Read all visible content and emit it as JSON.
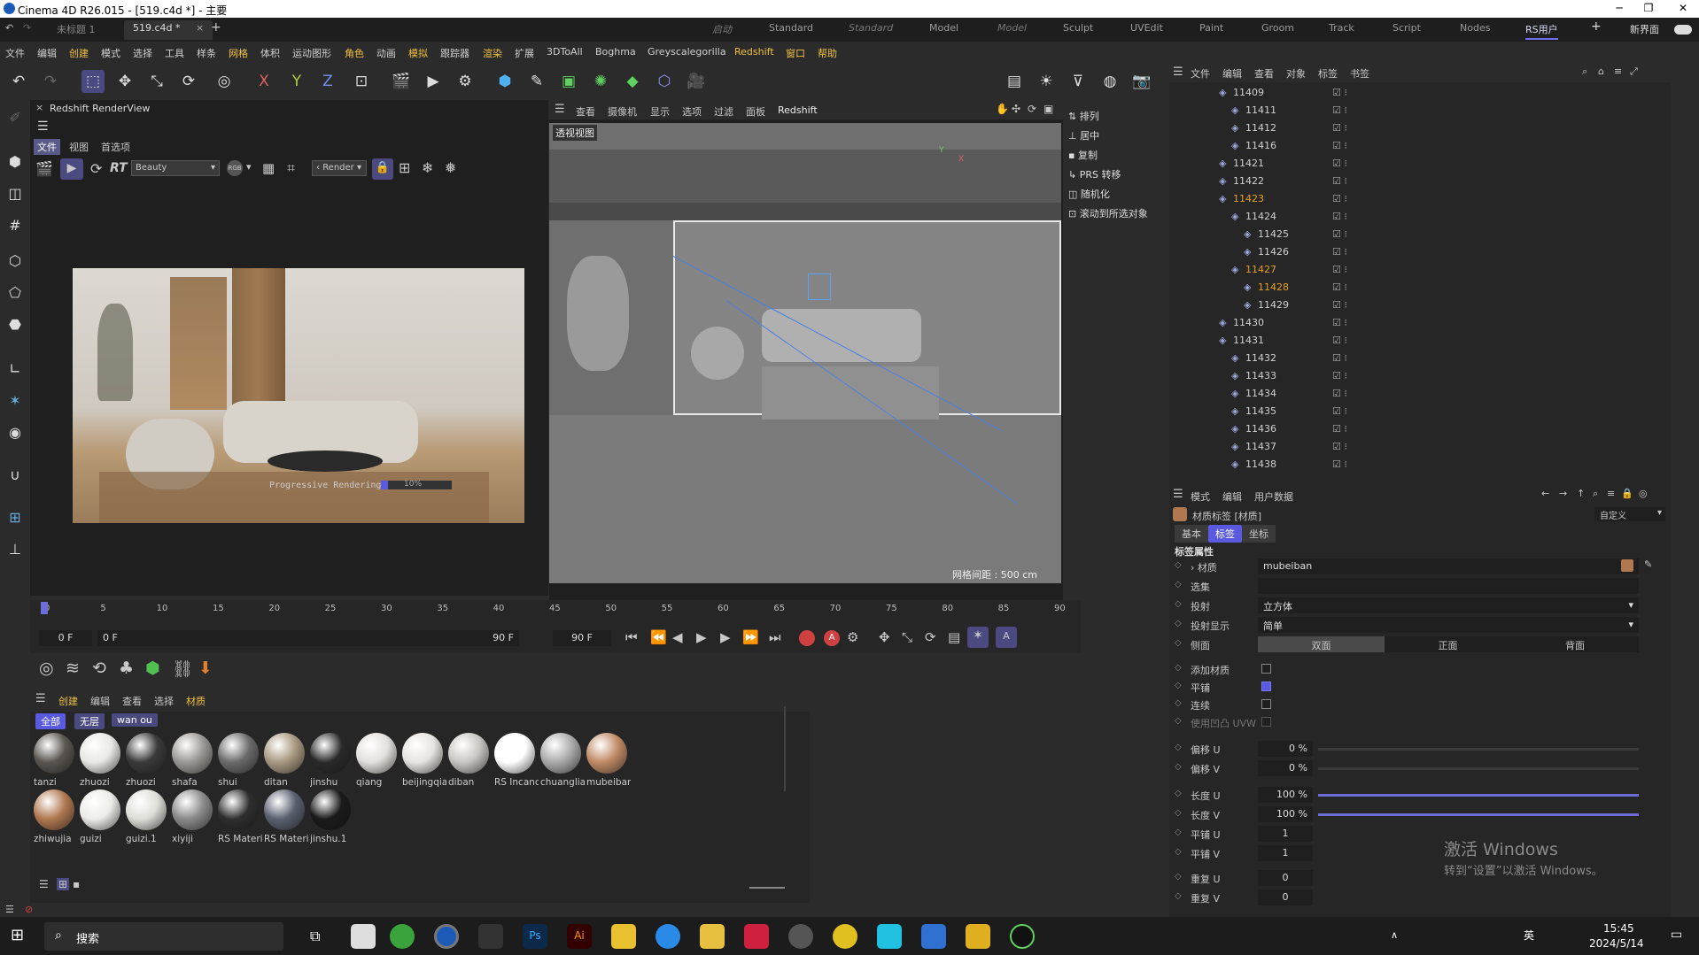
{
  "window": {
    "title": "Cinema 4D R26.015 - [519.c4d *] - 主要"
  },
  "tabs": [
    {
      "label": "未标题 1"
    },
    {
      "label": "519.c4d *"
    }
  ],
  "layouts": [
    "启动",
    "Standard",
    "Standard",
    "Model",
    "Model",
    "Sculpt",
    "UVEdit",
    "Paint",
    "Groom",
    "Track",
    "Script",
    "Nodes",
    "RS用户",
    "新界面"
  ],
  "menu": [
    "文件",
    "编辑",
    "创建",
    "模式",
    "选择",
    "工具",
    "样条",
    "网格",
    "体积",
    "运动图形",
    "角色",
    "动画",
    "模拟",
    "跟踪器",
    "渲染",
    "扩展",
    "3DToAll",
    "Boghma",
    "Greyscalegorilla",
    "Redshift",
    "窗口",
    "帮助"
  ],
  "renderview": {
    "title": "Redshift RenderView",
    "menu": [
      "文件",
      "视图",
      "首选项"
    ],
    "aov": "Beauty",
    "rgb": "RGB",
    "render_label": "Render",
    "rt_label": "RT",
    "progress_text": "Progressive Rendering...",
    "progress_pct": "10%",
    "progress_value": 0.1
  },
  "viewport": {
    "menu": [
      "查看",
      "摄像机",
      "显示",
      "选项",
      "过滤",
      "面板",
      "Redshift"
    ],
    "label": "透视视图",
    "grid": "网格间距 : 500 cm",
    "axis_y": "Y",
    "axis_x": "X"
  },
  "attr_tools": [
    "排列",
    "居中",
    "复制",
    "PRS 转移",
    "随机化",
    "滚动到所选对象"
  ],
  "objmgr": {
    "menu": [
      "文件",
      "编辑",
      "查看",
      "对象",
      "标签",
      "书签"
    ],
    "rows": [
      {
        "name": "11409",
        "hl": false
      },
      {
        "name": "11411",
        "hl": false
      },
      {
        "name": "11412",
        "hl": false
      },
      {
        "name": "11416",
        "hl": false
      },
      {
        "name": "11421",
        "hl": false
      },
      {
        "name": "11422",
        "hl": false
      },
      {
        "name": "11423",
        "hl": true
      },
      {
        "name": "11424",
        "hl": false
      },
      {
        "name": "11425",
        "hl": false
      },
      {
        "name": "11426",
        "hl": false
      },
      {
        "name": "11427",
        "hl": true
      },
      {
        "name": "11428",
        "hl": true
      },
      {
        "name": "11429",
        "hl": false
      },
      {
        "name": "11430",
        "hl": false
      },
      {
        "name": "11431",
        "hl": false
      },
      {
        "name": "11432",
        "hl": false
      },
      {
        "name": "11433",
        "hl": false
      },
      {
        "name": "11434",
        "hl": false
      },
      {
        "name": "11435",
        "hl": false
      },
      {
        "name": "11436",
        "hl": false
      },
      {
        "name": "11437",
        "hl": false
      },
      {
        "name": "11438",
        "hl": false
      }
    ]
  },
  "attr": {
    "menu": [
      "模式",
      "编辑",
      "用户数据"
    ],
    "header": "材质标签 [材质]",
    "preset": "自定义",
    "tabs": [
      "基本",
      "标签",
      "坐标"
    ],
    "section": "标签属性",
    "material_label": "材质",
    "material_value": "mubeiban",
    "selection_label": "选集",
    "projection_label": "投射",
    "projection_value": "立方体",
    "projdisp_label": "投射显示",
    "projdisp_value": "简单",
    "side_label": "侧面",
    "side_options": [
      "双面",
      "正面",
      "背面"
    ],
    "add_mat_label": "添加材质",
    "tile_label": "平铺",
    "seamless_label": "连续",
    "uvw_label": "使用凹凸 UVW",
    "offset_u_label": "偏移 U",
    "offset_u": "0 %",
    "offset_v_label": "偏移 V",
    "offset_v": "0 %",
    "length_u_label": "长度 U",
    "length_u": "100 %",
    "length_v_label": "长度 V",
    "length_v": "100 %",
    "tiles_u_label": "平铺 U",
    "tiles_u": "1",
    "tiles_v_label": "平铺 V",
    "tiles_v": "1",
    "repeat_u_label": "重复 U",
    "repeat_u": "0",
    "repeat_v_label": "重复 V",
    "repeat_v": "0"
  },
  "watermark": {
    "line1": "激活 Windows",
    "line2": "转到“设置”以激活 Windows。"
  },
  "timeline": {
    "ticks": [
      "0",
      "5",
      "10",
      "15",
      "20",
      "25",
      "30",
      "35",
      "40",
      "45",
      "50",
      "55",
      "60",
      "65",
      "70",
      "75",
      "80",
      "85",
      "90"
    ],
    "start": "0 F",
    "current": "0 F",
    "end": "90 F",
    "end2": "90 F"
  },
  "matmgr": {
    "menu": [
      "创建",
      "编辑",
      "查看",
      "选择",
      "材质"
    ],
    "filters": [
      "全部",
      "无层",
      "wan ou"
    ],
    "materials": [
      {
        "name": "tanzi",
        "color": "#5a5550"
      },
      {
        "name": "zhuozi",
        "color": "#e8e8e6"
      },
      {
        "name": "zhuozi",
        "color": "#3a3a3a"
      },
      {
        "name": "shafa",
        "color": "#9a9894"
      },
      {
        "name": "shui",
        "color": "#6a6a6a"
      },
      {
        "name": "ditan",
        "color": "#a89880"
      },
      {
        "name": "jinshu",
        "color": "#2a2a2a"
      },
      {
        "name": "qiang",
        "color": "#e2e0dc"
      },
      {
        "name": "beijingqiar",
        "color": "#e6e4e0"
      },
      {
        "name": "diban",
        "color": "#c8c6c2"
      },
      {
        "name": "RS Incande",
        "color": "#ffffff"
      },
      {
        "name": "chuangliar",
        "color": "#aaaaaa"
      },
      {
        "name": "mubeiban",
        "color": "#c08a65"
      },
      {
        "name": "zhiwujia",
        "color": "#b07850"
      },
      {
        "name": "guizi",
        "color": "#ecece8"
      },
      {
        "name": "guizi.1",
        "color": "#deded8"
      },
      {
        "name": "xiyiji",
        "color": "#8a8a8a"
      },
      {
        "name": "RS Materia",
        "color": "#2e2e2e"
      },
      {
        "name": "RS Materia",
        "color": "#5a6070"
      },
      {
        "name": "jinshu.1",
        "color": "#1a1a1a"
      }
    ]
  },
  "taskbar": {
    "search": "搜索",
    "time": "15:45",
    "date": "2024/5/14",
    "ime": "英"
  }
}
